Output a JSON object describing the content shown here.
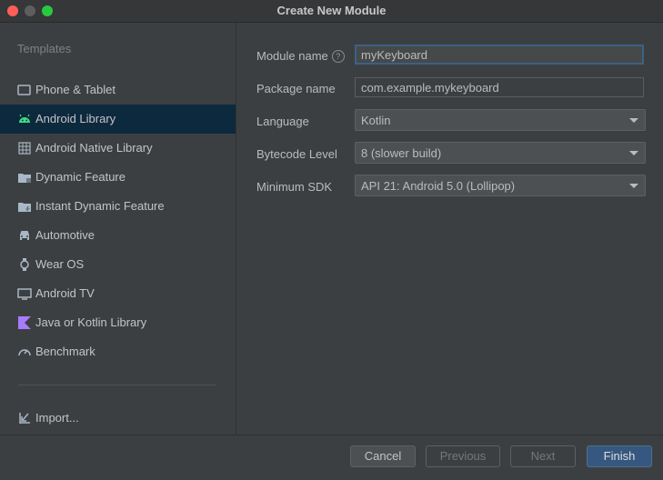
{
  "window": {
    "title": "Create New Module"
  },
  "sidebar": {
    "header": "Templates",
    "items": [
      {
        "label": "Phone & Tablet",
        "icon": "phone-tablet-icon"
      },
      {
        "label": "Android Library",
        "icon": "android-icon",
        "selected": true
      },
      {
        "label": "Android Native Library",
        "icon": "native-library-icon"
      },
      {
        "label": "Dynamic Feature",
        "icon": "folder-icon"
      },
      {
        "label": "Instant Dynamic Feature",
        "icon": "folder-icon"
      },
      {
        "label": "Automotive",
        "icon": "car-icon"
      },
      {
        "label": "Wear OS",
        "icon": "watch-icon"
      },
      {
        "label": "Android TV",
        "icon": "tv-icon"
      },
      {
        "label": "Java or Kotlin Library",
        "icon": "kotlin-icon"
      },
      {
        "label": "Benchmark",
        "icon": "gauge-icon"
      }
    ],
    "import_label": "Import..."
  },
  "form": {
    "module_name": {
      "label": "Module name",
      "value": "myKeyboard"
    },
    "package_name": {
      "label": "Package name",
      "value": "com.example.mykeyboard"
    },
    "language": {
      "label": "Language",
      "value": "Kotlin"
    },
    "bytecode": {
      "label": "Bytecode Level",
      "value": "8 (slower build)"
    },
    "min_sdk": {
      "label": "Minimum SDK",
      "value": "API 21: Android 5.0 (Lollipop)"
    }
  },
  "footer": {
    "cancel": "Cancel",
    "previous": "Previous",
    "next": "Next",
    "finish": "Finish"
  },
  "colors": {
    "selection": "#0d293e",
    "accent": "#365880",
    "android_green": "#3ddc84",
    "kotlin_purple": "#a97bff"
  }
}
